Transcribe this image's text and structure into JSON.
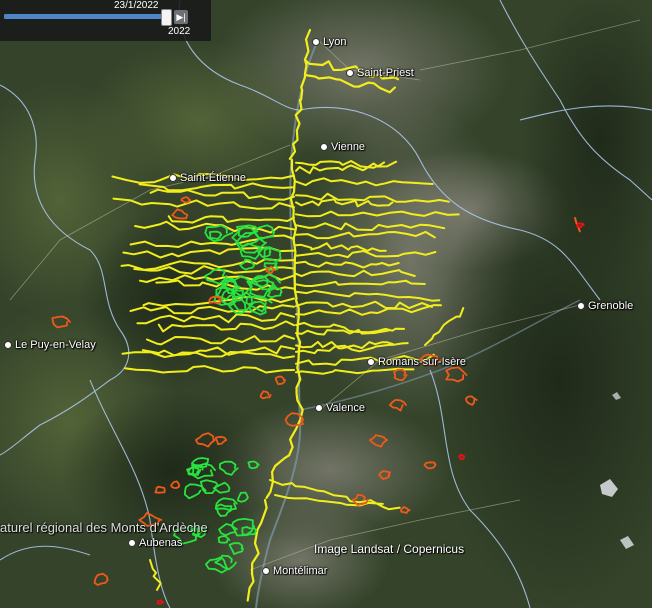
{
  "timeline": {
    "current_date": "23/1/2022",
    "end_year": "2022",
    "progress": 0.97,
    "end_button_icon": "skip-to-end-icon"
  },
  "places": [
    {
      "name": "Lyon"
    },
    {
      "name": "Saint-Priest"
    },
    {
      "name": "Vienne"
    },
    {
      "name": "Saint-Étienne"
    },
    {
      "name": "Grenoble"
    },
    {
      "name": "Le Puy-en-Velay"
    },
    {
      "name": "Romans-sur-Isère"
    },
    {
      "name": "Valence"
    },
    {
      "name": "Aubenas"
    },
    {
      "name": "Montélimar"
    }
  ],
  "park_label": "aturel régional des Monts d'Ardèche",
  "attribution": "Image Landsat / Copernicus",
  "colors": {
    "track_yellow": "#f2ee1c",
    "track_green": "#29e23f",
    "track_orange": "#ee5a1a",
    "track_red": "#e01414",
    "boundary": "#a9c4ea",
    "terrain_dark": "#2f3d24",
    "valley_light": "#7d7e6a"
  }
}
